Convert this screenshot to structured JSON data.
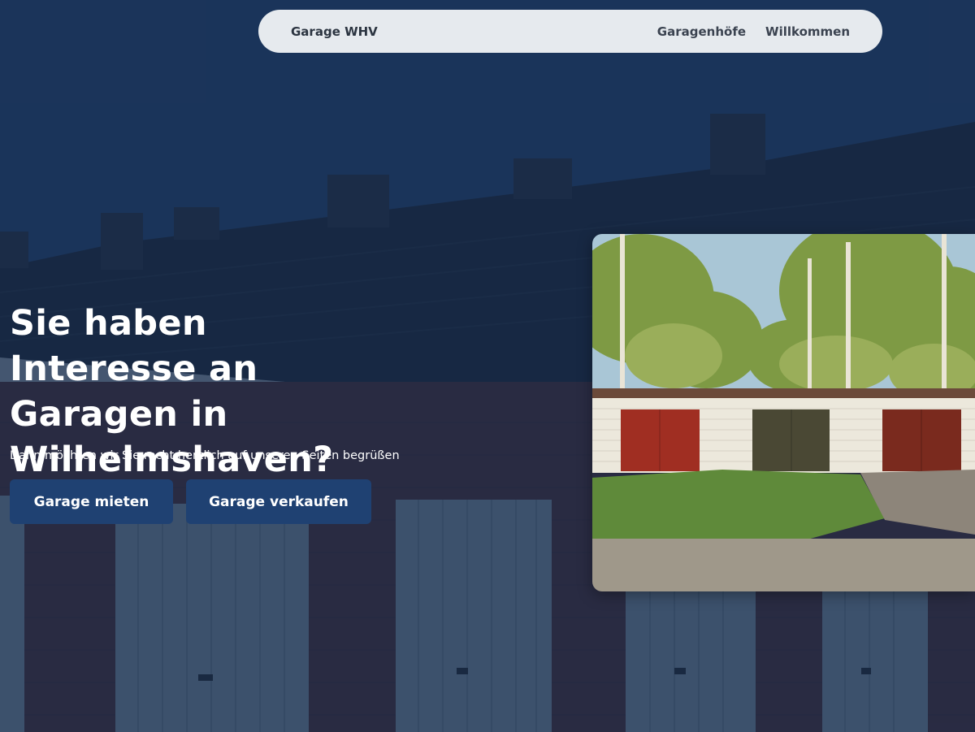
{
  "nav": {
    "brand": "Garage WHV",
    "links": [
      {
        "label": "Garagenhöfe"
      },
      {
        "label": "Willkommen"
      }
    ]
  },
  "hero": {
    "title": "Sie haben Interesse an Garagen in Wilhelmshaven?",
    "subtitle": "Dann möchten wir Sie recht herzlich auf unseren Seiten begrüßen",
    "buttons": {
      "rent": "Garage mieten",
      "sell": "Garage verkaufen"
    }
  },
  "colors": {
    "navbar_bg": "#e6eaee",
    "overlay": "#162c4e",
    "button_bg": "#1f4172",
    "text_light": "#ffffff"
  }
}
